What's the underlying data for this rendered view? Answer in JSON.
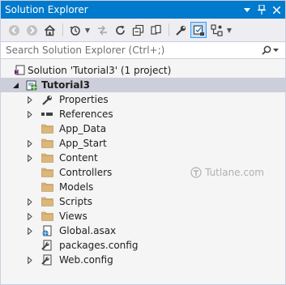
{
  "window": {
    "title": "Solution Explorer"
  },
  "toolbar": {
    "icons": [
      "back-icon",
      "forward-icon",
      "home-icon",
      "history-icon",
      "sync-icon",
      "refresh-icon",
      "collapse-all-icon",
      "show-all-files-icon",
      "properties-icon",
      "preview-icon",
      "view-icon"
    ]
  },
  "search": {
    "placeholder": "Search Solution Explorer (Ctrl+;)"
  },
  "tree": {
    "solution": "Solution 'Tutorial3' (1 project)",
    "project": "Tutorial3",
    "items": [
      {
        "label": "Properties",
        "icon": "wrench-icon"
      },
      {
        "label": "References",
        "icon": "references-icon"
      },
      {
        "label": "App_Data",
        "icon": "folder-icon"
      },
      {
        "label": "App_Start",
        "icon": "folder-icon"
      },
      {
        "label": "Content",
        "icon": "folder-icon"
      },
      {
        "label": "Controllers",
        "icon": "folder-icon"
      },
      {
        "label": "Models",
        "icon": "folder-icon"
      },
      {
        "label": "Scripts",
        "icon": "folder-icon"
      },
      {
        "label": "Views",
        "icon": "folder-icon"
      },
      {
        "label": "Global.asax",
        "icon": "asax-file-icon"
      },
      {
        "label": "packages.config",
        "icon": "config-file-icon"
      },
      {
        "label": "Web.config",
        "icon": "config-file-icon"
      }
    ]
  },
  "watermark": {
    "text": "Tutlane.com"
  },
  "colors": {
    "accent": "#007acc",
    "selection": "#cccedb",
    "folder": "#dcb67a"
  }
}
